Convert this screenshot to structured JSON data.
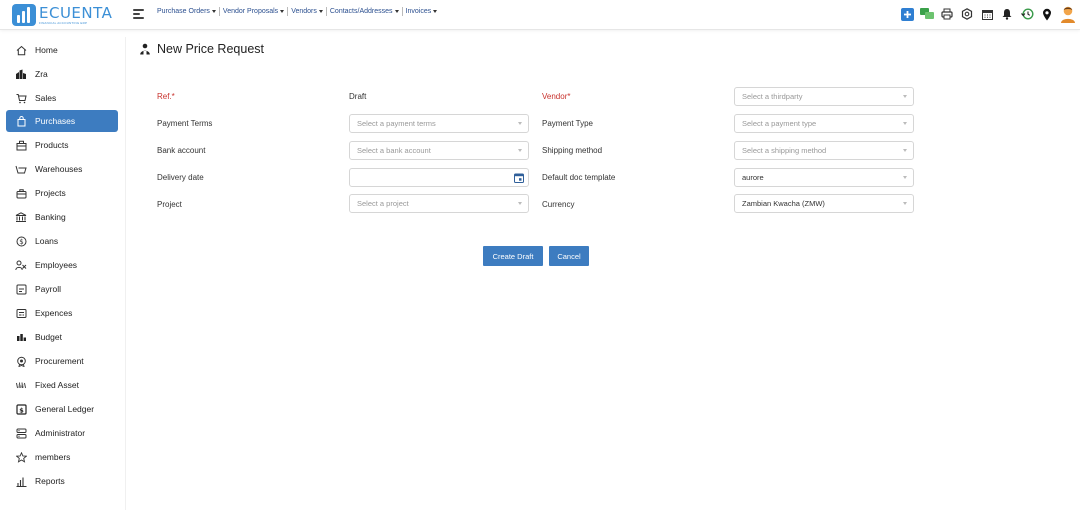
{
  "app": {
    "logo_name": "ECUENTA",
    "logo_tagline": "FINANCIAL ACCOUNTING ERP"
  },
  "topnav": {
    "items": [
      {
        "label": "Purchase Orders"
      },
      {
        "label": "Vendor Proposals"
      },
      {
        "label": "Vendors"
      },
      {
        "label": "Contacts/Addresses"
      },
      {
        "label": "Invoices"
      }
    ]
  },
  "sidebar": {
    "items": [
      {
        "label": "Home",
        "icon": "home-icon"
      },
      {
        "label": "Zra",
        "icon": "building-icon"
      },
      {
        "label": "Sales",
        "icon": "cart-icon"
      },
      {
        "label": "Purchases",
        "icon": "bag-icon",
        "active": true
      },
      {
        "label": "Products",
        "icon": "box-icon"
      },
      {
        "label": "Warehouses",
        "icon": "warehouse-icon"
      },
      {
        "label": "Projects",
        "icon": "briefcase-icon"
      },
      {
        "label": "Banking",
        "icon": "bank-icon"
      },
      {
        "label": "Loans",
        "icon": "dollar-icon"
      },
      {
        "label": "Employees",
        "icon": "users-icon"
      },
      {
        "label": "Payroll",
        "icon": "payroll-icon"
      },
      {
        "label": "Expences",
        "icon": "expense-icon"
      },
      {
        "label": "Budget",
        "icon": "budget-icon"
      },
      {
        "label": "Procurement",
        "icon": "gear-badge-icon"
      },
      {
        "label": "Fixed Asset",
        "icon": "asset-icon"
      },
      {
        "label": "General Ledger",
        "icon": "ledger-icon"
      },
      {
        "label": "Administrator",
        "icon": "admin-icon"
      },
      {
        "label": "members",
        "icon": "star-icon"
      },
      {
        "label": "Reports",
        "icon": "bar-chart-icon"
      }
    ]
  },
  "page": {
    "title": "New Price Request"
  },
  "form": {
    "ref_label": "Ref.*",
    "ref_value": "Draft",
    "vendor_label": "Vendor*",
    "vendor_placeholder": "Select a thirdparty",
    "payment_terms_label": "Payment Terms",
    "payment_terms_placeholder": "Select a payment terms",
    "payment_type_label": "Payment Type",
    "payment_type_placeholder": "Select a payment type",
    "bank_account_label": "Bank account",
    "bank_account_placeholder": "Select a bank account",
    "shipping_method_label": "Shipping method",
    "shipping_method_placeholder": "Select a shipping method",
    "delivery_date_label": "Delivery date",
    "delivery_date_value": "",
    "doc_template_label": "Default doc template",
    "doc_template_value": "aurore",
    "project_label": "Project",
    "project_placeholder": "Select a project",
    "currency_label": "Currency",
    "currency_value": "Zambian Kwacha (ZMW)"
  },
  "actions": {
    "create_draft": "Create Draft",
    "cancel": "Cancel"
  },
  "colors": {
    "accent": "#3d7cc0",
    "required": "#c8312c",
    "link": "#2b4f8f"
  }
}
